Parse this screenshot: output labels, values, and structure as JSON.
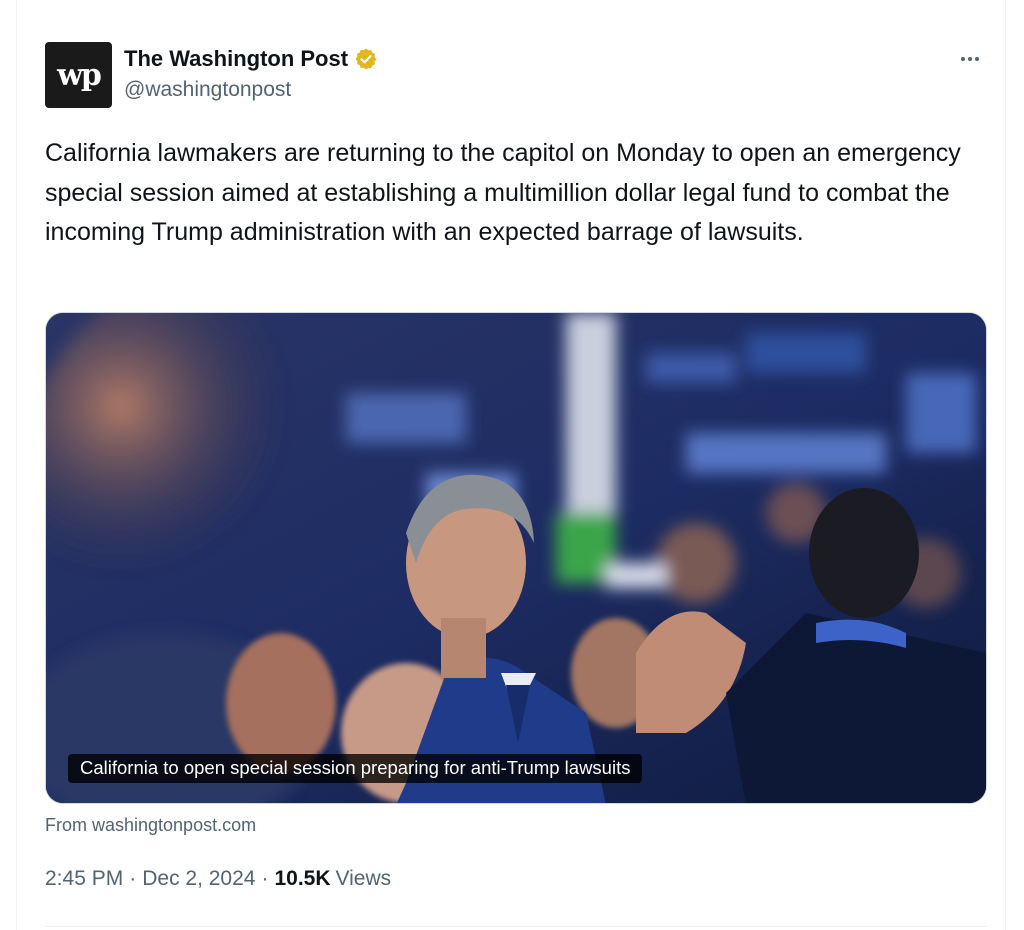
{
  "author": {
    "avatar_text": "wp",
    "name": "The Washington Post",
    "verified_icon": "verified-badge-gold",
    "handle": "@washingtonpost"
  },
  "tweet": {
    "text": "California lawmakers are returning to the capitol on Monday to open an emergency special session aimed at establishing a multimillion dollar legal fund to combat the incoming Trump administration with an expected barrage of lawsuits."
  },
  "link_card": {
    "caption": "California to open special session preparing for anti-Trump lawsuits",
    "source": "From washingtonpost.com"
  },
  "meta": {
    "time": "2:45 PM",
    "separator": "·",
    "date": "Dec 2, 2024",
    "views_count": "10.5K",
    "views_label": "Views"
  },
  "colors": {
    "text_primary": "#0f1419",
    "text_secondary": "#536471",
    "verified_gold": "#e2b719"
  }
}
